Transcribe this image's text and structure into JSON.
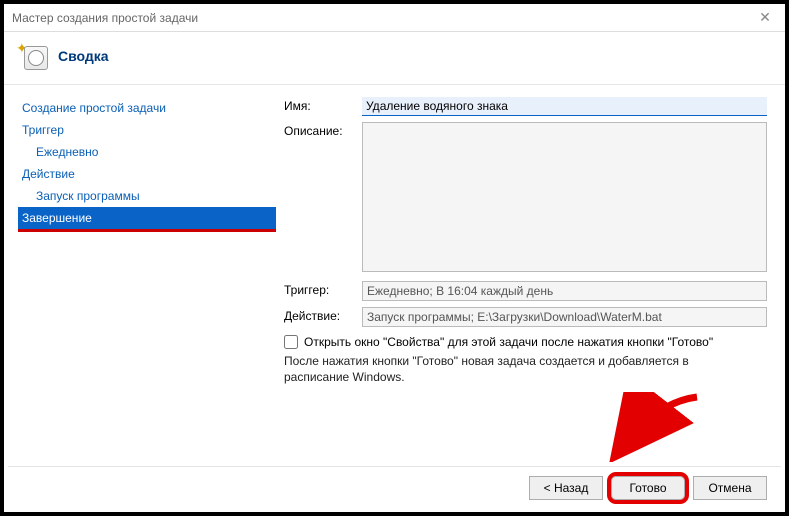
{
  "window": {
    "title": "Мастер создания простой задачи"
  },
  "header": {
    "title": "Сводка"
  },
  "sidebar": {
    "items": [
      {
        "label": "Создание простой задачи",
        "indent": 0
      },
      {
        "label": "Триггер",
        "indent": 0
      },
      {
        "label": "Ежедневно",
        "indent": 1
      },
      {
        "label": "Действие",
        "indent": 0
      },
      {
        "label": "Запуск программы",
        "indent": 1
      },
      {
        "label": "Завершение",
        "indent": 0,
        "selected": true
      }
    ]
  },
  "form": {
    "name_label": "Имя:",
    "name_value": "Удаление водяного знака",
    "desc_label": "Описание:",
    "desc_value": "",
    "trigger_label": "Триггер:",
    "trigger_value": "Ежедневно; В 16:04 каждый день",
    "action_label": "Действие:",
    "action_value": "Запуск программы; E:\\Загрузки\\Download\\WaterM.bat",
    "checkbox_label": "Открыть окно \"Свойства\" для этой задачи после нажатия кнопки \"Готово\"",
    "hint": "После нажатия кнопки \"Готово\" новая задача создается и добавляется в расписание Windows."
  },
  "buttons": {
    "back": "< Назад",
    "finish": "Готово",
    "cancel": "Отмена"
  }
}
